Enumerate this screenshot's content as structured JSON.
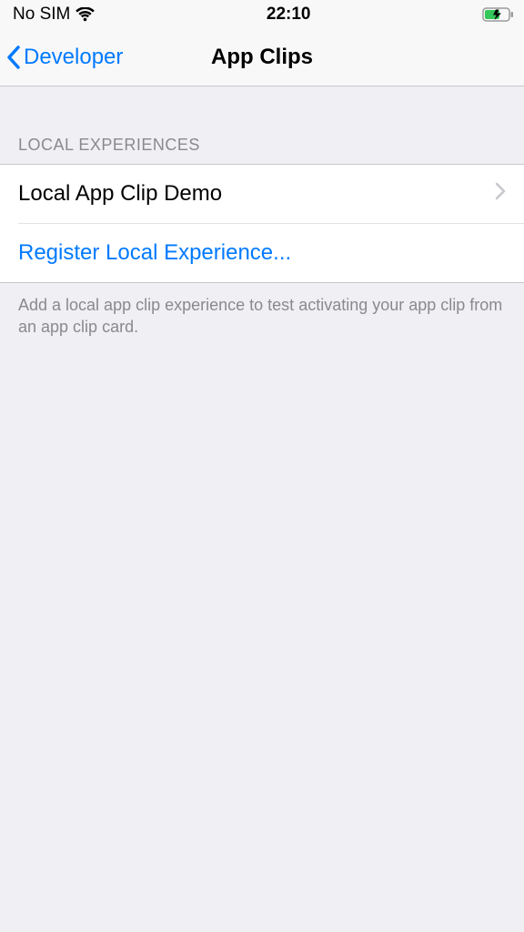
{
  "status": {
    "left_text": "No SIM",
    "time": "22:10"
  },
  "nav": {
    "back_label": "Developer",
    "title": "App Clips"
  },
  "section": {
    "header": "LOCAL EXPERIENCES",
    "items": {
      "demo_label": "Local App Clip Demo",
      "register_label": "Register Local Experience..."
    },
    "footer": "Add a local app clip experience to test activating your app clip from an app clip card."
  }
}
